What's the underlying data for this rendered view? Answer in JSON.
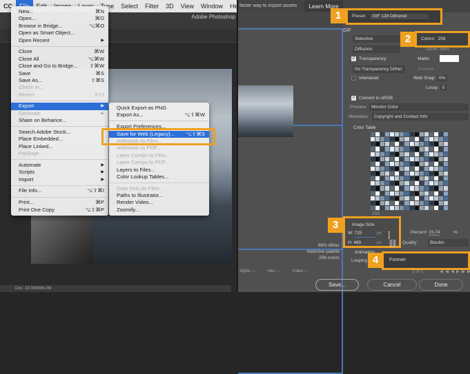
{
  "photoshop": {
    "menubar": [
      "CC",
      "File",
      "Edit",
      "Image",
      "Layer",
      "Type",
      "Select",
      "Filter",
      "3D",
      "View",
      "Window",
      "Help"
    ],
    "app_title": "Adobe Photoshop",
    "status": "Doc: 18.0M/846.0M",
    "file_menu": [
      {
        "label": "New...",
        "shortcut": "⌘N"
      },
      {
        "label": "Open...",
        "shortcut": "⌘O"
      },
      {
        "label": "Browse in Bridge...",
        "shortcut": "⌥⌘O"
      },
      {
        "label": "Open as Smart Object...",
        "shortcut": ""
      },
      {
        "label": "Open Recent",
        "shortcut": "▶"
      },
      {
        "sep": true
      },
      {
        "label": "Close",
        "shortcut": "⌘W"
      },
      {
        "label": "Close All",
        "shortcut": "⌥⌘W"
      },
      {
        "label": "Close and Go to Bridge...",
        "shortcut": "⇧⌘W"
      },
      {
        "label": "Save",
        "shortcut": "⌘S"
      },
      {
        "label": "Save As...",
        "shortcut": "⇧⌘S"
      },
      {
        "label": "Check In...",
        "shortcut": "",
        "disabled": true
      },
      {
        "label": "Revert",
        "shortcut": "F12",
        "disabled": true
      },
      {
        "sep": true
      },
      {
        "label": "Export",
        "shortcut": "▶",
        "highlight": true
      },
      {
        "label": "Generate",
        "shortcut": "▶",
        "disabled": true
      },
      {
        "label": "Share on Behance...",
        "shortcut": ""
      },
      {
        "sep": true
      },
      {
        "label": "Search Adobe Stock...",
        "shortcut": ""
      },
      {
        "label": "Place Embedded...",
        "shortcut": ""
      },
      {
        "label": "Place Linked...",
        "shortcut": ""
      },
      {
        "label": "Package...",
        "shortcut": "",
        "disabled": true
      },
      {
        "sep": true
      },
      {
        "label": "Automate",
        "shortcut": "▶"
      },
      {
        "label": "Scripts",
        "shortcut": "▶"
      },
      {
        "label": "Import",
        "shortcut": "▶"
      },
      {
        "sep": true
      },
      {
        "label": "File Info...",
        "shortcut": "⌥⇧⌘I"
      },
      {
        "sep": true
      },
      {
        "label": "Print...",
        "shortcut": "⌘P"
      },
      {
        "label": "Print One Copy",
        "shortcut": "⌥⇧⌘P"
      }
    ],
    "export_menu": [
      {
        "label": "Quick Export as PNG",
        "shortcut": ""
      },
      {
        "label": "Export As...",
        "shortcut": "⌥⇧⌘W"
      },
      {
        "sep": true
      },
      {
        "label": "Export Preferences...",
        "shortcut": ""
      },
      {
        "label": "Save for Web (Legacy)...",
        "shortcut": "⌥⇧⌘S",
        "highlight": true
      },
      {
        "label": "Artboards to Files...",
        "shortcut": "",
        "disabled": true
      },
      {
        "label": "Artboards to PDF...",
        "shortcut": "",
        "disabled": true
      },
      {
        "label": "Layer Comps to Files...",
        "shortcut": "",
        "disabled": true
      },
      {
        "label": "Layer Comps to PDF...",
        "shortcut": "",
        "disabled": true
      },
      {
        "label": "Layers to Files...",
        "shortcut": ""
      },
      {
        "label": "Color Lookup Tables...",
        "shortcut": ""
      },
      {
        "sep": true
      },
      {
        "label": "Data Sets as Files...",
        "shortcut": "",
        "disabled": true
      },
      {
        "label": "Paths to Illustrator...",
        "shortcut": ""
      },
      {
        "label": "Render Video...",
        "shortcut": ""
      },
      {
        "label": "Zoomify...",
        "shortcut": ""
      }
    ]
  },
  "dialog": {
    "banner": "faster way to export assets",
    "learn_more": "Learn More",
    "preset_label": "Preset:",
    "preset_value": "GIF 128 Dithered",
    "format": "GIF",
    "reduction": "Selective",
    "colors_label": "Colors:",
    "colors_value": "256",
    "dither_algo": "Diffusion",
    "dither_label": "Dither:",
    "dither_value": "88%",
    "transparency": "Transparency",
    "matte_label": "Matte:",
    "transparency_dither": "No Transparency Dither",
    "amount_label": "Amount:",
    "interlaced": "Interlaced",
    "websnap_label": "Web Snap:",
    "websnap_value": "0%",
    "lossy_label": "Lossy:",
    "lossy_value": "0",
    "convert_srgb": "Convert to sRGB",
    "preview_label": "Preview:",
    "preview_value": "Monitor Color",
    "metadata_label": "Metadata:",
    "metadata_value": "Copyright and Contact Info",
    "color_table": "Color Table",
    "color_count": "256",
    "image_size": "Image Size",
    "w_label": "W:",
    "w_value": "725",
    "h_label": "H:",
    "h_value": "489",
    "px": "px",
    "percent_label": "Percent:",
    "percent_value": "23.74",
    "percent_unit": "%",
    "quality_label": "Quality:",
    "quality_value": "Bicubic",
    "animation": "Animation",
    "looping_label": "Looping Options:",
    "looping_value": "Forever",
    "frame_counter": "1 of 1",
    "info": [
      "88% dither",
      "Selective palette",
      "256 colors"
    ],
    "alpha": "Alpha: --",
    "hex": "Hex: --",
    "index": "Index: --",
    "save": "Save...",
    "cancel": "Cancel",
    "done": "Done",
    "callouts": [
      "1",
      "2",
      "3",
      "4"
    ]
  },
  "colors": {
    "accent": "#f0a020",
    "highlight": "#2d6fd8",
    "frame": "#4b78b5"
  }
}
